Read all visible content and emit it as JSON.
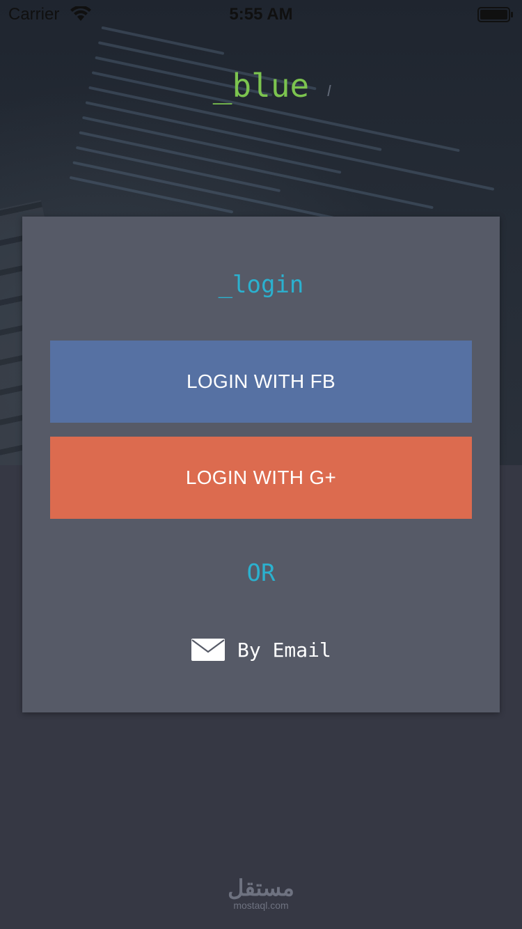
{
  "status_bar": {
    "carrier": "Carrier",
    "time": "5:55 AM"
  },
  "brand": {
    "title": "_blue",
    "color": "#7cc44f"
  },
  "login_card": {
    "title": "_login",
    "facebook_button_label": "LOGIN WITH FB",
    "google_button_label": "LOGIN WITH G+",
    "divider_text": "OR",
    "email_label": "By Email",
    "colors": {
      "facebook": "#5671a3",
      "google": "#dc6b4f",
      "accent": "#2bb1cf",
      "card_background": "#565a67"
    }
  },
  "watermark": {
    "logo_text": "مستقل",
    "url": "mostaql.com"
  },
  "icons": {
    "status": [
      "wifi-icon",
      "battery-icon"
    ],
    "email": "mail-icon"
  }
}
